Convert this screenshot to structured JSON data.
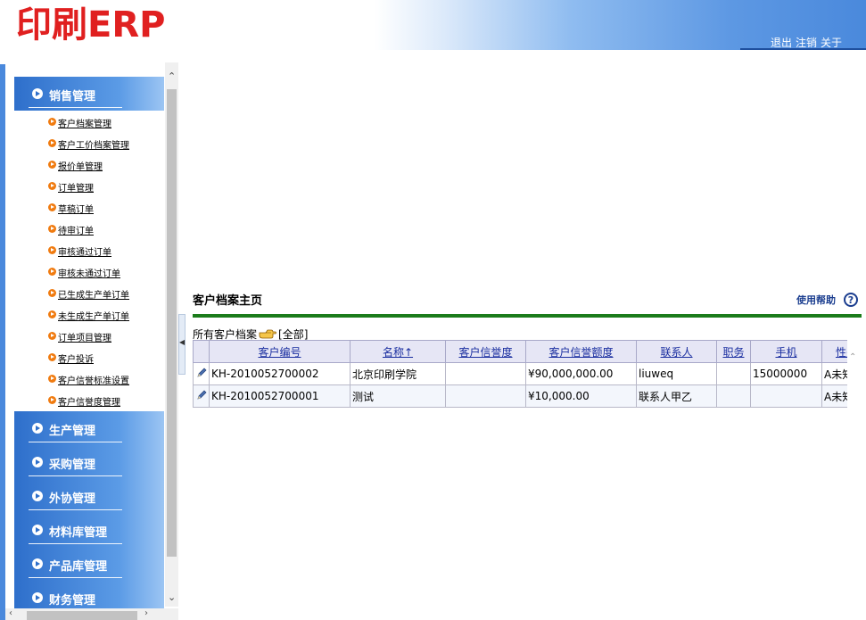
{
  "header": {
    "logo": "印刷ERP",
    "links": [
      "退出",
      "注销",
      "关于"
    ]
  },
  "sidebar": {
    "groups": [
      {
        "label": "销售管理",
        "expanded": true,
        "items": [
          "客户档案管理",
          "客户工价档案管理",
          "报价单管理",
          "订单管理",
          "草稿订单",
          "待审订单",
          "审核通过订单",
          "审核未通过订单",
          "已生成生产单订单",
          "未生成生产单订单",
          "订单项目管理",
          "客户投诉",
          "客户信誉标准设置",
          "客户信誉度管理"
        ]
      },
      {
        "label": "生产管理"
      },
      {
        "label": "采购管理"
      },
      {
        "label": "外协管理"
      },
      {
        "label": "材料库管理"
      },
      {
        "label": "产品库管理"
      },
      {
        "label": "财务管理"
      }
    ]
  },
  "main": {
    "title": "客户档案主页",
    "help_label": "使用帮助",
    "help_icon_glyph": "?",
    "filter_label": "所有客户档案",
    "filter_value": "[全部]",
    "columns": [
      "客户编号",
      "名称↑",
      "客户信誉度",
      "客户信誉额度",
      "联系人",
      "职务",
      "手机",
      "性别"
    ],
    "rows": [
      {
        "code": "KH-2010052700002",
        "name": "北京印刷学院",
        "credit_level": "",
        "credit_limit": "¥90,000,000.00",
        "contact": "liuweq",
        "position": "",
        "mobile": "15000000",
        "gender": "A未知"
      },
      {
        "code": "KH-2010052700001",
        "name": "测试",
        "credit_level": "",
        "credit_limit": "¥10,000.00",
        "contact": "联系人甲乙",
        "position": "",
        "mobile": "",
        "gender": "A未知"
      }
    ]
  },
  "colors": {
    "logo": "#e02020",
    "menu_blue": "#2e6fcb",
    "bullet_orange": "#f07b10",
    "rule_green": "#1b7c1b",
    "header_link_blue": "#1a2ea0"
  }
}
